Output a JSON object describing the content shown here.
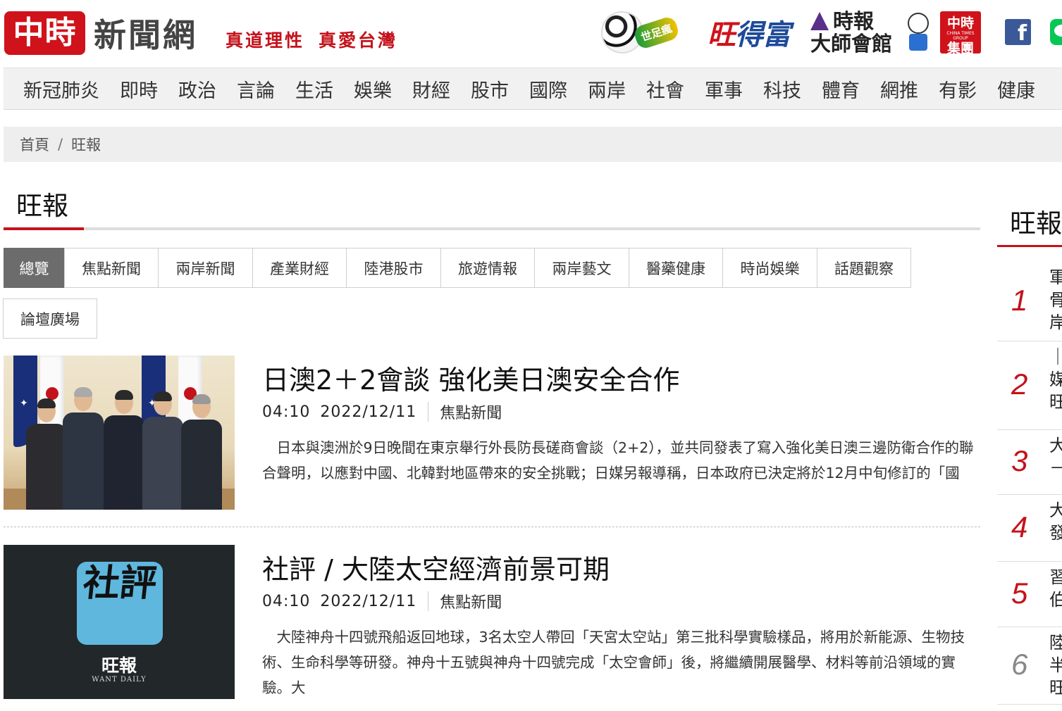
{
  "header": {
    "logo_mark": "中時",
    "logo_text": "新聞網",
    "slogan_1": "真道理性",
    "slogan_2": "真愛台灣",
    "brand_ball_tag": "世足瘋",
    "brand_want_1": "旺",
    "brand_want_2": "得富",
    "brand_times_1": "時報",
    "brand_times_2": "大師會館",
    "brand_ctg_1": "中時",
    "brand_ctg_2": "集團",
    "brand_ctg_sub": "CHINA TIMES GROUP",
    "facebook_glyph": "f"
  },
  "nav": {
    "items": [
      "新冠肺炎",
      "即時",
      "政治",
      "言論",
      "生活",
      "娛樂",
      "財經",
      "股市",
      "國際",
      "兩岸",
      "社會",
      "軍事",
      "科技",
      "體育",
      "網推",
      "有影",
      "健康"
    ]
  },
  "breadcrumb": {
    "home": "首頁",
    "separator": "/",
    "current": "旺報"
  },
  "section": {
    "title": "旺報"
  },
  "tabs": {
    "active_index": 0,
    "items": [
      "總覽",
      "焦點新聞",
      "兩岸新聞",
      "產業財經",
      "陸港股市",
      "旅遊情報",
      "兩岸藝文",
      "醫藥健康",
      "時尚娛樂",
      "話題觀察",
      "論壇廣場"
    ]
  },
  "articles": [
    {
      "title": "日澳2＋2會談 強化美日澳安全合作",
      "time": "04:10",
      "date": "2022/12/11",
      "category": "焦點新聞",
      "excerpt": "日本與澳洲於9日晚間在東京舉行外長防長磋商會談（2+2），並共同發表了寫入強化美日澳三邊防衛合作的聯合聲明，以應對中國、北韓對地區帶來的安全挑戰；日媒另報導稱，日本政府已決定將於12月中旬修訂的「國"
    },
    {
      "title": "社評 / 大陸太空經濟前景可期",
      "time": "04:10",
      "date": "2022/12/11",
      "category": "焦點新聞",
      "excerpt": "大陸神舟十四號飛船返回地球，3名太空人帶回「天宮太空站」第三批科學實驗樣品，將用於新能源、生物技術、生命科學等研發。神舟十五號與神舟十四號完成「太空會師」後，將繼續開展醫學、材料等前沿領域的實驗。大",
      "thumb_big": "社評",
      "thumb_brand": "旺報",
      "thumb_brand_sub": "WANT DAILY"
    }
  ],
  "sidebar": {
    "title": "旺報",
    "ranks": [
      {
        "num": "1",
        "text": "軍骨岸"
      },
      {
        "num": "2",
        "text": "｜媒旺"
      },
      {
        "num": "3",
        "text": "大－"
      },
      {
        "num": "4",
        "text": "大發"
      },
      {
        "num": "5",
        "text": "習伯"
      },
      {
        "num": "6",
        "text": "陸半旺"
      }
    ]
  },
  "colors": {
    "brand_red": "#c4121b",
    "tab_active_bg": "#6c6c6c",
    "nav_bg": "#f1f1f1",
    "facebook": "#3b5998",
    "line": "#06c755"
  }
}
